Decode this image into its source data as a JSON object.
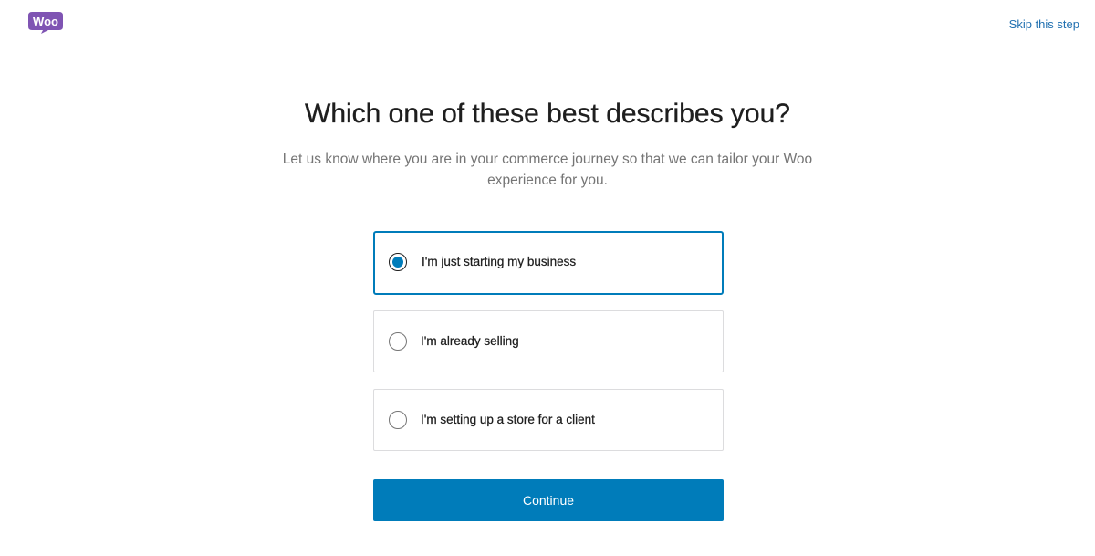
{
  "header": {
    "logo_text": "Woo",
    "skip_label": "Skip this step"
  },
  "main": {
    "title": "Which one of these best describes you?",
    "subtitle": "Let us know where you are in your commerce journey so that we can tailor your Woo experience for you.",
    "options": [
      {
        "label": "I'm just starting my business",
        "selected": true
      },
      {
        "label": "I'm already selling",
        "selected": false
      },
      {
        "label": "I'm setting up a store for a client",
        "selected": false
      }
    ],
    "continue_label": "Continue"
  },
  "colors": {
    "brand": "#7f54b3",
    "accent": "#007cba",
    "link": "#2271b1"
  }
}
